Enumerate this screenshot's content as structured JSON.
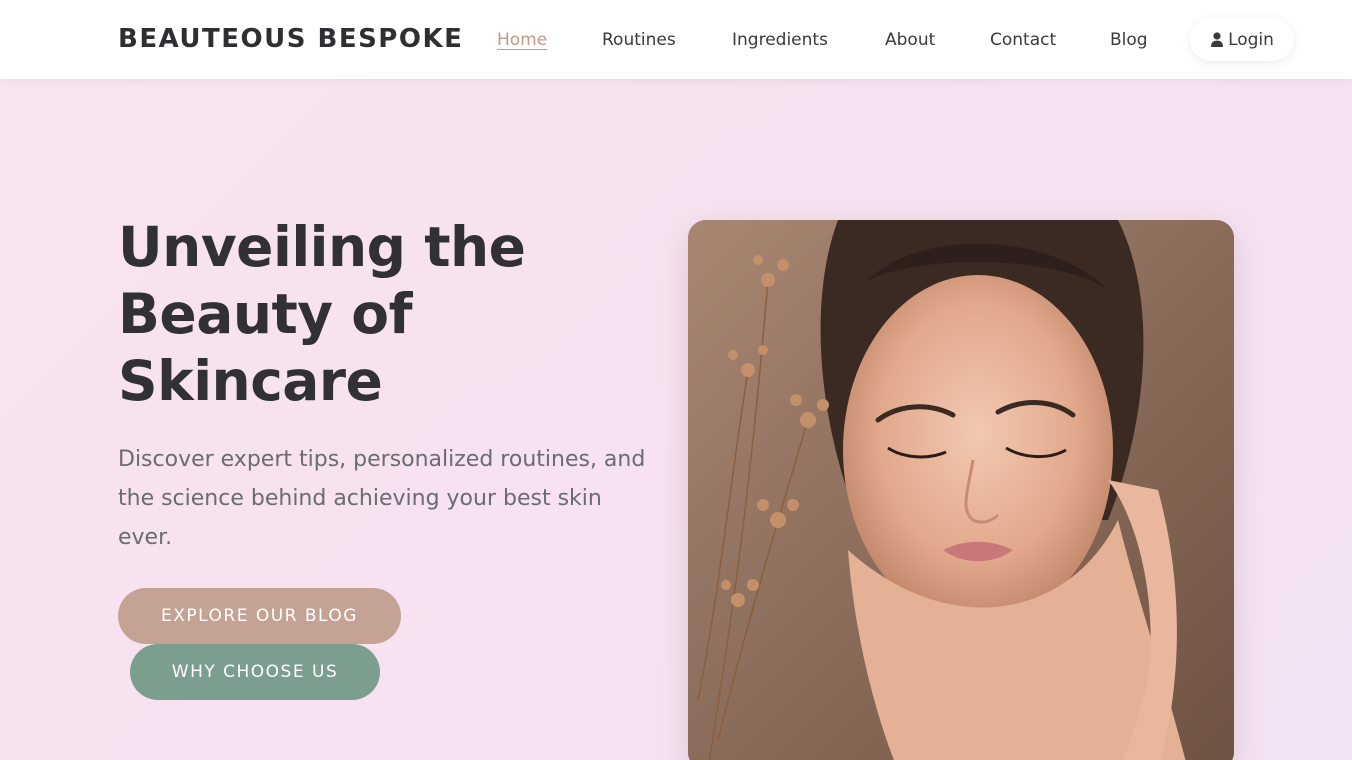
{
  "brand": "BEAUTEOUS BESPOKE",
  "nav": {
    "items": [
      {
        "label": "Home",
        "active": true
      },
      {
        "label": "Routines",
        "active": false
      },
      {
        "label": "Ingredients",
        "active": false
      },
      {
        "label": "About",
        "active": false
      },
      {
        "label": "Contact",
        "active": false
      },
      {
        "label": "Blog",
        "active": false
      }
    ],
    "login_label": "Login",
    "login_icon": "user-icon"
  },
  "hero": {
    "title": "Unveiling the Beauty of Skincare",
    "description": "Discover expert tips, personalized routines, and the science behind achieving your best skin ever.",
    "primary_button": "EXPLORE OUR BLOG",
    "secondary_button": "WHY CHOOSE US"
  },
  "colors": {
    "accent": "#c09a86",
    "primary_button": "#c4a394",
    "secondary_button": "#7b9e8f",
    "hero_bg": "#f7e3ee",
    "text_dark": "#303036"
  }
}
